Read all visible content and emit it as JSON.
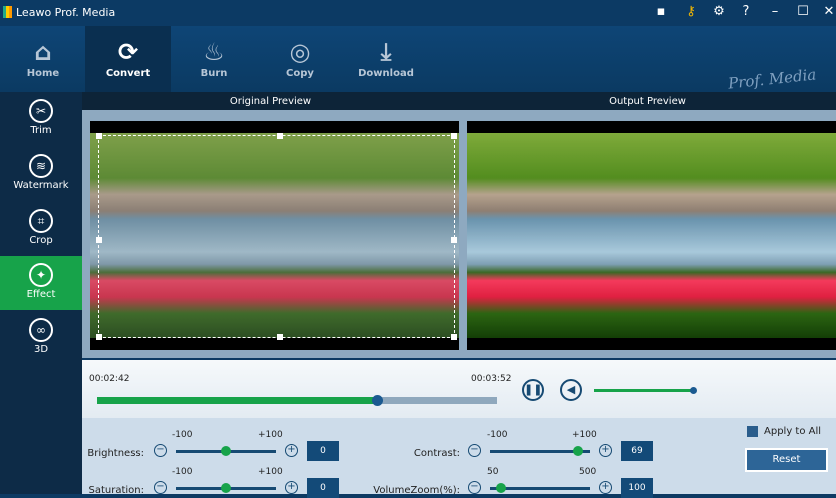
{
  "app": {
    "title": "Leawo Prof. Media",
    "brand": "Prof. Media"
  },
  "window_controls": [
    "chat-icon",
    "key-icon",
    "gear-icon",
    "help-icon",
    "minimize-icon",
    "maximize-icon",
    "close-icon"
  ],
  "toolbar": [
    {
      "label": "Home",
      "icon": "home-icon"
    },
    {
      "label": "Convert",
      "icon": "convert-icon",
      "selected": true
    },
    {
      "label": "Burn",
      "icon": "burn-icon"
    },
    {
      "label": "Copy",
      "icon": "copy-icon"
    },
    {
      "label": "Download",
      "icon": "download-icon"
    }
  ],
  "sidebar": [
    {
      "label": "Trim",
      "icon": "scissors-icon"
    },
    {
      "label": "Watermark",
      "icon": "watermark-icon"
    },
    {
      "label": "Crop",
      "icon": "crop-icon"
    },
    {
      "label": "Effect",
      "icon": "effect-icon",
      "selected": true
    },
    {
      "label": "3D",
      "icon": "3d-glasses-icon"
    }
  ],
  "preview": {
    "original": "Original Preview",
    "output": "Output Preview"
  },
  "player": {
    "current_time": "00:02:42",
    "total_time": "00:03:52",
    "progress": 0.7,
    "volume": 1.0
  },
  "effects": {
    "brightness": {
      "label": "Brightness:",
      "min": "-100",
      "max": "+100",
      "value": "0"
    },
    "saturation": {
      "label": "Saturation:",
      "min": "-100",
      "max": "+100",
      "value": "0"
    },
    "contrast": {
      "label": "Contrast:",
      "min": "-100",
      "max": "+100",
      "value": "69"
    },
    "volume_zoom": {
      "label": "VolumeZoom(%):",
      "min": "50",
      "max": "500",
      "value": "100"
    },
    "apply_all": "Apply to All",
    "reset": "Reset"
  },
  "colors": {
    "accent": "#17a34a",
    "navy": "#0c3a64"
  }
}
